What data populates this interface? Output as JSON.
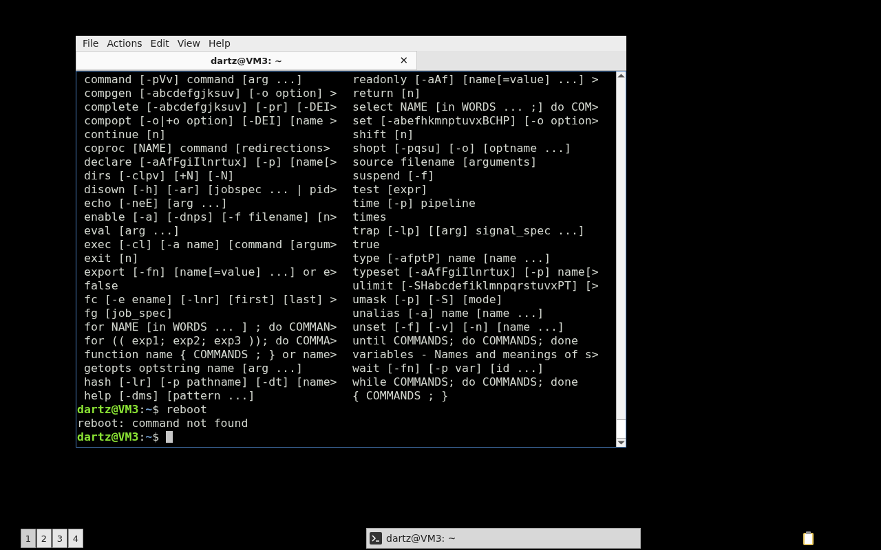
{
  "window": {
    "menu": [
      "File",
      "Actions",
      "Edit",
      "View",
      "Help"
    ],
    "tabs": [
      {
        "title": "dartz@VM3: ~",
        "selected": true,
        "close": "✕"
      }
    ]
  },
  "terminal": {
    "help_rows": [
      {
        "left": "command [-pVv] command [arg ...]",
        "right": "readonly [-aAf] [name[=value] ...] >"
      },
      {
        "left": "compgen [-abcdefgjksuv] [-o option] >",
        "right": "return [n]"
      },
      {
        "left": "complete [-abcdefgjksuv] [-pr] [-DEI>",
        "right": "select NAME [in WORDS ... ;] do COM>"
      },
      {
        "left": "compopt [-o|+o option] [-DEI] [name >",
        "right": "set [-abefhkmnptuvxBCHP] [-o option>"
      },
      {
        "left": "continue [n]",
        "right": "shift [n]"
      },
      {
        "left": "coproc [NAME] command [redirections>",
        "right": "shopt [-pqsu] [-o] [optname ...]"
      },
      {
        "left": "declare [-aAfFgiIlnrtux] [-p] [name[>",
        "right": "source filename [arguments]"
      },
      {
        "left": "dirs [-clpv] [+N] [-N]",
        "right": "suspend [-f]"
      },
      {
        "left": "disown [-h] [-ar] [jobspec ... | pid>",
        "right": "test [expr]"
      },
      {
        "left": "echo [-neE] [arg ...]",
        "right": "time [-p] pipeline"
      },
      {
        "left": "enable [-a] [-dnps] [-f filename] [n>",
        "right": "times"
      },
      {
        "left": "eval [arg ...]",
        "right": "trap [-lp] [[arg] signal_spec ...]"
      },
      {
        "left": "exec [-cl] [-a name] [command [argum>",
        "right": "true"
      },
      {
        "left": "exit [n]",
        "right": "type [-afptP] name [name ...]"
      },
      {
        "left": "export [-fn] [name[=value] ...] or e>",
        "right": "typeset [-aAfFgiIlnrtux] [-p] name[>"
      },
      {
        "left": "false",
        "right": "ulimit [-SHabcdefiklmnpqrstuvxPT] [>"
      },
      {
        "left": "fc [-e ename] [-lnr] [first] [last] >",
        "right": "umask [-p] [-S] [mode]"
      },
      {
        "left": "fg [job_spec]",
        "right": "unalias [-a] name [name ...]"
      },
      {
        "left": "for NAME [in WORDS ... ] ; do COMMAN>",
        "right": "unset [-f] [-v] [-n] [name ...]"
      },
      {
        "left": "for (( exp1; exp2; exp3 )); do COMMA>",
        "right": "until COMMANDS; do COMMANDS; done"
      },
      {
        "left": "function name { COMMANDS ; } or name>",
        "right": "variables - Names and meanings of s>"
      },
      {
        "left": "getopts optstring name [arg ...]",
        "right": "wait [-fn] [-p var] [id ...]"
      },
      {
        "left": "hash [-lr] [-p pathname] [-dt] [name>",
        "right": "while COMMANDS; do COMMANDS; done"
      },
      {
        "left": "help [-dms] [pattern ...]",
        "right": "{ COMMANDS ; }"
      }
    ],
    "lines": [
      {
        "kind": "prompt",
        "user_host": "dartz@VM3",
        "separator": ":",
        "path": "~",
        "symbol": "$",
        "command": "reboot",
        "cursor": false
      },
      {
        "kind": "output",
        "text": "reboot: command not found"
      },
      {
        "kind": "prompt",
        "user_host": "dartz@VM3",
        "separator": ":",
        "path": "~",
        "symbol": "$",
        "cursor": true
      }
    ]
  },
  "taskbar": {
    "workspaces": [
      {
        "label": "1",
        "selected": true
      },
      {
        "label": "2",
        "selected": false
      },
      {
        "label": "3",
        "selected": false
      },
      {
        "label": "4",
        "selected": false
      }
    ],
    "tasks": [
      {
        "title": "dartz@VM3: ~"
      }
    ]
  }
}
